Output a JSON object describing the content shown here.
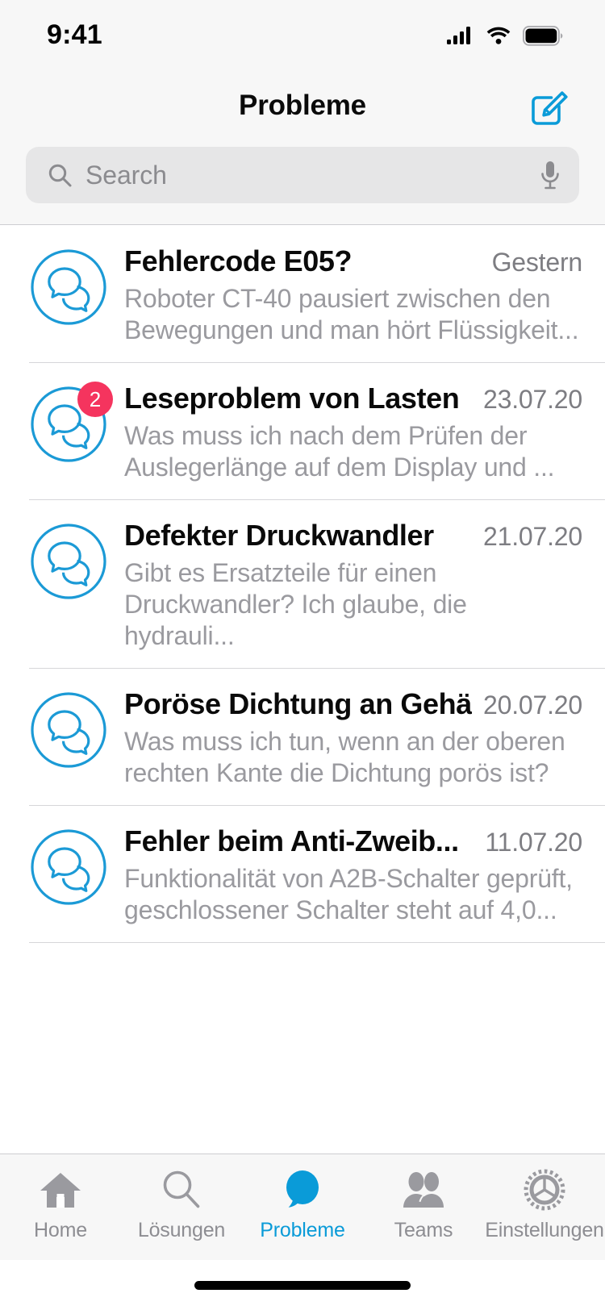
{
  "status_bar": {
    "time": "9:41",
    "signal_icon": "cellular-signal-icon",
    "wifi_icon": "wifi-icon",
    "battery_icon": "battery-full-icon"
  },
  "nav": {
    "title": "Probleme",
    "compose_icon": "compose-icon",
    "accent_color": "#0a9bd8"
  },
  "search": {
    "placeholder": "Search",
    "search_icon": "search-icon",
    "mic_icon": "microphone-icon"
  },
  "list": {
    "items": [
      {
        "title": "Fehlercode E05?",
        "date": "Gestern",
        "preview": "Roboter CT-40 pausiert zwischen den Bewegungen und man hört Flüssigkeit...",
        "badge": "",
        "avatar_icon": "chat-bubbles-avatar-icon"
      },
      {
        "title": "Leseproblem von Lasten",
        "date": "23.07.20",
        "preview": "Was muss ich nach dem Prüfen der Auslegerlänge auf dem Display und ...",
        "badge": "2",
        "avatar_icon": "chat-bubbles-avatar-icon"
      },
      {
        "title": "Defekter Druckwandler",
        "date": "21.07.20",
        "preview": "Gibt es Ersatzteile für einen Druckwandler? Ich glaube, die hydrauli...",
        "badge": "",
        "avatar_icon": "chat-bubbles-avatar-icon"
      },
      {
        "title": "Poröse Dichtung an Gehä...",
        "date": "20.07.20",
        "preview": "Was muss ich tun, wenn an der oberen rechten Kante die Dichtung porös ist?",
        "badge": "",
        "avatar_icon": "chat-bubbles-avatar-icon"
      },
      {
        "title": "Fehler beim Anti-Zweib...",
        "date": "11.07.20",
        "preview": "Funktionalität von A2B-Schalter geprüft, geschlossener Schalter steht auf 4,0...",
        "badge": "",
        "avatar_icon": "chat-bubbles-avatar-icon"
      }
    ]
  },
  "tab_bar": {
    "active_color": "#0a9bd8",
    "inactive_color": "#8d8d92",
    "tabs": [
      {
        "label": "Home",
        "icon": "home-icon",
        "active": false
      },
      {
        "label": "Lösungen",
        "icon": "search-icon",
        "active": false
      },
      {
        "label": "Probleme",
        "icon": "chat-bubble-icon",
        "active": true
      },
      {
        "label": "Teams",
        "icon": "people-icon",
        "active": false
      },
      {
        "label": "Einstellungen",
        "icon": "gear-icon",
        "active": false
      }
    ]
  },
  "badge_color": "#f5345e"
}
